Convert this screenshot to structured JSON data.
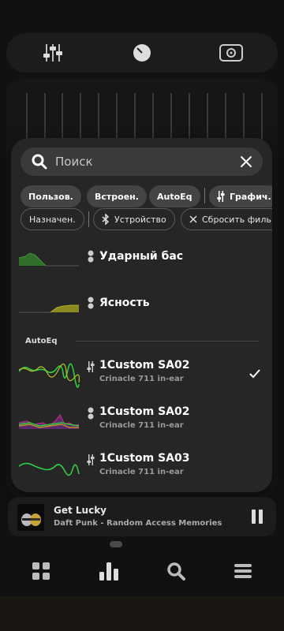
{
  "colors": {
    "accent_green": "#2ecc40",
    "accent_olive": "#8a8a20",
    "sheet_bg": "#262626",
    "chip_filled": "#444444"
  },
  "toolbar": {
    "icons": [
      "equalizer-sliders-icon",
      "knob-icon",
      "speaker-icon"
    ]
  },
  "search": {
    "placeholder": "Поиск"
  },
  "chips_row1": [
    {
      "label": "Пользов.",
      "style": "filled"
    },
    {
      "label": "Встроен.",
      "style": "filled"
    },
    {
      "label": "AutoEq",
      "style": "filled"
    },
    {
      "label": "Графич.",
      "style": "filled",
      "icon": "graphic-eq-icon"
    }
  ],
  "chips_row2": [
    {
      "label": "Назначен.",
      "style": "outline"
    },
    {
      "label": "Устройство",
      "style": "outline",
      "icon": "bluetooth-icon"
    },
    {
      "label": "Сбросить филь",
      "style": "outline",
      "icon": "close-icon"
    }
  ],
  "builtin_presets": [
    {
      "title": "Ударный бас",
      "type_icon": "parametric-eq-icon",
      "curve": "bass"
    },
    {
      "title": "Ясность",
      "type_icon": "parametric-eq-icon",
      "curve": "clarity"
    }
  ],
  "autoeq_section": {
    "label": "AutoEq"
  },
  "autoeq_presets": [
    {
      "title": "1Custom SA02",
      "subtitle": "Crinacle 711 in-ear",
      "type_icon": "graphic-eq-icon",
      "selected": true
    },
    {
      "title": "1Custom SA02",
      "subtitle": "Crinacle 711 in-ear",
      "type_icon": "parametric-eq-icon",
      "selected": false
    },
    {
      "title": "1Custom SA03",
      "subtitle": "Crinacle 711 in-ear",
      "type_icon": "graphic-eq-icon",
      "selected": false
    }
  ],
  "player": {
    "title": "Get Lucky",
    "artist": "Daft Punk - Random Access Memories"
  },
  "bottom_nav": [
    "grid-icon",
    "bar-chart-icon",
    "search-icon",
    "menu-icon"
  ]
}
